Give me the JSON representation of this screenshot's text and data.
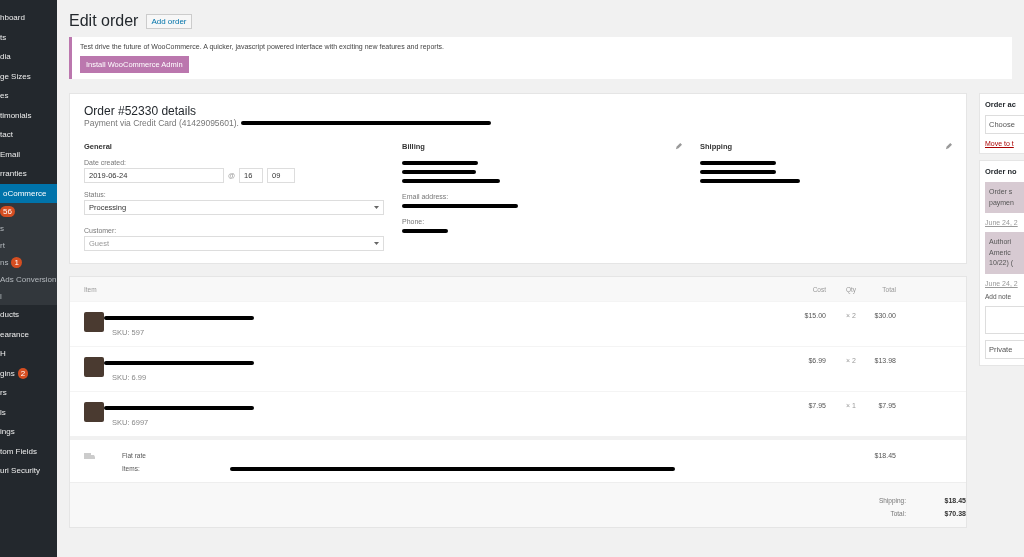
{
  "sidebar": {
    "items": [
      {
        "label": "hboard",
        "selected": false,
        "sub": false
      },
      {
        "label": "ts",
        "selected": false,
        "sub": false
      },
      {
        "label": "dia",
        "selected": false,
        "sub": false
      },
      {
        "label": "ge Sizes",
        "selected": false,
        "sub": false
      },
      {
        "label": "es",
        "selected": false,
        "sub": false
      },
      {
        "label": "timonials",
        "selected": false,
        "sub": false
      },
      {
        "label": "tact",
        "selected": false,
        "sub": false
      },
      {
        "label": " Email",
        "selected": false,
        "sub": false
      },
      {
        "label": "rranties",
        "selected": false,
        "sub": false
      },
      {
        "label": "oCommerce",
        "selected": true,
        "sub": false
      },
      {
        "badge": "56",
        "selected": false,
        "sub": true
      },
      {
        "label": "s",
        "selected": false,
        "sub": true
      },
      {
        "label": "rt",
        "selected": false,
        "sub": true
      },
      {
        "label": "ns",
        "badge": "1",
        "selected": false,
        "sub": true
      },
      {
        "label": "Ads Conversion",
        "selected": false,
        "sub": true
      },
      {
        "label": "l",
        "selected": false,
        "sub": true
      },
      {
        "label": "ducts",
        "selected": false,
        "sub": false
      },
      {
        "label": "earance",
        "selected": false,
        "sub": false
      },
      {
        "label": "H",
        "selected": false,
        "sub": false
      },
      {
        "label": "gins",
        "badge": "2",
        "selected": false,
        "sub": false
      },
      {
        "label": "rs",
        "selected": false,
        "sub": false
      },
      {
        "label": "ls",
        "selected": false,
        "sub": false
      },
      {
        "label": "ings",
        "selected": false,
        "sub": false
      },
      {
        "label": "tom Fields",
        "selected": false,
        "sub": false
      },
      {
        "label": "uri Security",
        "selected": false,
        "sub": false
      }
    ]
  },
  "header": {
    "title": "Edit order",
    "button": "Add order"
  },
  "notice": {
    "text": "Test drive the future of WooCommerce. A quicker, javascript powered interface with exciting new features and reports.",
    "button": "Install WooCommerce Admin"
  },
  "order": {
    "title": "Order #52330 details",
    "payment": "Payment via Credit Card (41429095601).",
    "general": {
      "heading": "General",
      "date_label": "Date created:",
      "date": "2019-06-24",
      "at": "@",
      "hour": "16",
      "minute": "09",
      "status_label": "Status:",
      "status": "Processing",
      "customer_label": "Customer:",
      "customer_placeholder": "Guest"
    },
    "billing": {
      "heading": "Billing",
      "email_label": "Email address:",
      "phone_label": "Phone:"
    },
    "shipping": {
      "heading": "Shipping"
    }
  },
  "items": {
    "columns": [
      "Item",
      "Cost",
      "Qty",
      "Total"
    ],
    "rows": [
      {
        "sku": "SKU: 597",
        "cost": "$15.00",
        "qty": "× 2",
        "total": "$30.00"
      },
      {
        "sku": "SKU: 6.99",
        "cost": "$6.99",
        "qty": "× 2",
        "total": "$13.98"
      },
      {
        "sku": "SKU: 6997",
        "cost": "$7.95",
        "qty": "× 1",
        "total": "$7.95"
      }
    ],
    "shipping_line": {
      "name": "Flat rate",
      "items_label": "Items:",
      "total": "$18.45"
    },
    "totals": [
      {
        "label": "Shipping:",
        "value": "$18.45"
      },
      {
        "label": "Total:",
        "value": "$70.38"
      }
    ]
  },
  "actions": {
    "heading": "Order ac",
    "select": "Choose",
    "link": "Move to t"
  },
  "notes": {
    "heading": "Order no",
    "entries": [
      {
        "lines": [
          "Order s",
          "paymen"
        ],
        "date": "June 24, 2"
      },
      {
        "lines": [
          "Authori",
          "Americ",
          "10/22) ("
        ],
        "date": "June 24, 2"
      }
    ],
    "add_label": "Add note",
    "type": "Private"
  }
}
